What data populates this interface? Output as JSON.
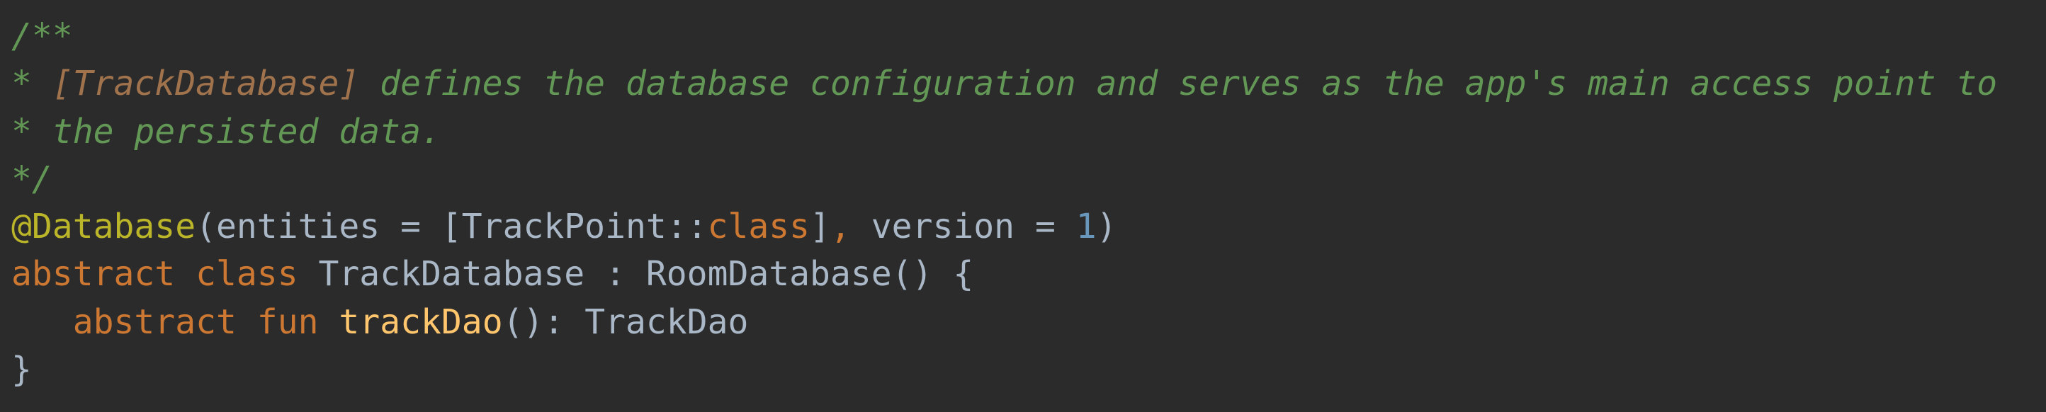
{
  "code": {
    "l1_doc": "/**",
    "l2_star": "* ",
    "l2_tag": "[TrackDatabase]",
    "l2_text": " defines the database configuration and serves as the app's main access point to",
    "l3_text": "* the persisted data.",
    "l4_doc": "*/",
    "l5_annotation": "@Database",
    "l5_open": "(entities = [TrackPoint::",
    "l5_class_kw": "class",
    "l5_close_bracket": "]",
    "l5_comma": ",",
    "l5_version": " version = ",
    "l5_num": "1",
    "l5_paren": ")",
    "l6_abstract": "abstract",
    "l6_class": "class",
    "l6_rest": " TrackDatabase : RoomDatabase() {",
    "l7_indent": "   ",
    "l7_abstract": "abstract",
    "l7_fun": "fun",
    "l7_fn_name": "trackDao",
    "l7_rest": "(): TrackDao",
    "l8_brace": "}"
  },
  "colors": {
    "background": "#2b2b2b",
    "doc_comment": "#629755",
    "doc_tag": "#a0734d",
    "annotation": "#bbb529",
    "keyword": "#cc7832",
    "number": "#6897bb",
    "function": "#ffc66d",
    "plain": "#a9b7c6"
  }
}
